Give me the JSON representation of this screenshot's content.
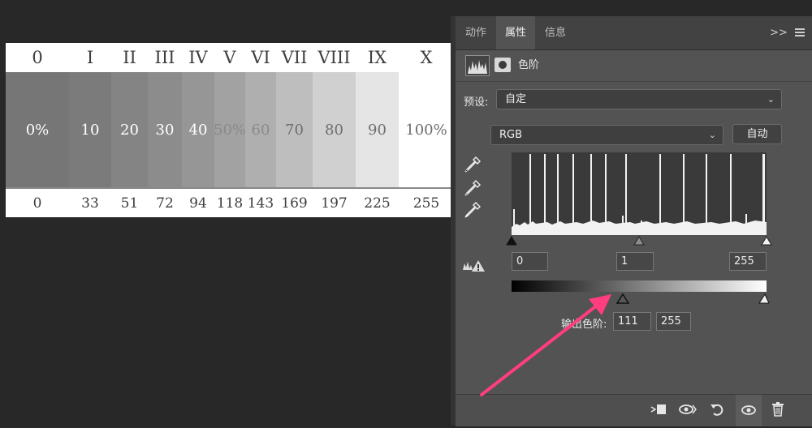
{
  "chart": {
    "roman": [
      "0",
      "I",
      "II",
      "III",
      "IV",
      "V",
      "VI",
      "VII",
      "VIII",
      "IX",
      "X"
    ],
    "percent": [
      "0%",
      "10",
      "20",
      "30",
      "40",
      "50%",
      "60",
      "70",
      "80",
      "90",
      "100%"
    ],
    "values": [
      "0",
      "33",
      "51",
      "72",
      "94",
      "118",
      "143",
      "169",
      "197",
      "225",
      "255"
    ],
    "swatch_colors": [
      "#767676",
      "#7b7b7b",
      "#848484",
      "#8c8c8c",
      "#969696",
      "#a2a2a2",
      "#afafaf",
      "#bebebe",
      "#d0d0d0",
      "#e5e5e5",
      "#ffffff"
    ],
    "text_colors": [
      "#ffffff",
      "#ffffff",
      "#ffffff",
      "#ffffff",
      "#ffffff",
      "#8a8a8a",
      "#8a8a8a",
      "#6e6e6e",
      "#6e6e6e",
      "#6e6e6e",
      "#6e6e6e"
    ]
  },
  "panel": {
    "tabs": [
      {
        "label": "动作",
        "active": false
      },
      {
        "label": "属性",
        "active": true
      },
      {
        "label": "信息",
        "active": false
      }
    ],
    "collapse_glyph": ">>",
    "title": "色阶",
    "preset_label": "预设:",
    "preset_value": "自定",
    "channel_value": "RGB",
    "auto_button": "自动",
    "input_black": "0",
    "input_gamma": "1",
    "input_white": "255",
    "output_label": "输出色阶:",
    "output_black": "111",
    "output_white": "255",
    "accent_arrow_color": "#ff3d7f"
  },
  "icons": {
    "eyedroppers": [
      "black-point-eyedropper-icon",
      "gray-point-eyedropper-icon",
      "white-point-eyedropper-icon"
    ],
    "footer": [
      "clip-to-layer-icon",
      "view-previous-state-icon",
      "reset-icon",
      "toggle-visibility-icon",
      "delete-icon"
    ]
  }
}
